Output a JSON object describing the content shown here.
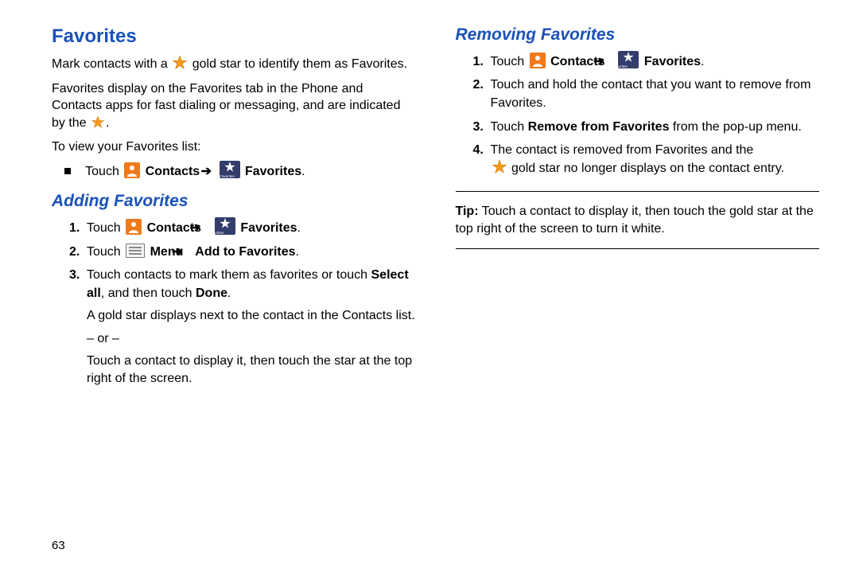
{
  "left": {
    "h1": "Favorites",
    "p1a": "Mark contacts with a ",
    "p1b": " gold star to identify them as Favorites.",
    "p2": "Favorites display on the Favorites tab in the Phone and Contacts apps for fast dialing or messaging, and are indicated by the ",
    "p2end": ".",
    "p3": "To view your Favorites list:",
    "bullet_touch": "Touch ",
    "contacts": "Contacts",
    "favorites": "Favorites",
    "period": ".",
    "h2": "Adding Favorites",
    "s2_touch": "Touch ",
    "menu": "Menu",
    "addto": "Add to Favorites",
    "s3a": "Touch contacts to mark them as favorites or touch ",
    "s3b": "Select all",
    "s3c": ", and then touch ",
    "s3d": "Done",
    "s3e": ".",
    "after1": "A gold star displays next to the contact in the Contacts list.",
    "or": "– or –",
    "after2": "Touch a contact to display it, then touch the star at the top right of the screen.",
    "fav_label": "Favorites",
    "n1": "1.",
    "n2": "2.",
    "n3": "3."
  },
  "right": {
    "h2": "Removing Favorites",
    "touch": "Touch ",
    "contacts": "Contacts",
    "favorites": "Favorites",
    "period": ".",
    "s2": "Touch and hold the contact that you want to remove from Favorites.",
    "s3a": "Touch ",
    "s3b": "Remove from Favorites",
    "s3c": " from the pop-up menu.",
    "s4a": "The contact is removed from Favorites and the",
    "s4b": " gold star no longer displays on the contact entry.",
    "tip_label": "Tip:",
    "tip": " Touch a contact to display it, then touch the gold star at the top right of the screen to turn it white.",
    "fav_label": "Favorites",
    "n1": "1.",
    "n2": "2.",
    "n3": "3.",
    "n4": "4."
  },
  "pagenum": "63",
  "arrow": "➔"
}
